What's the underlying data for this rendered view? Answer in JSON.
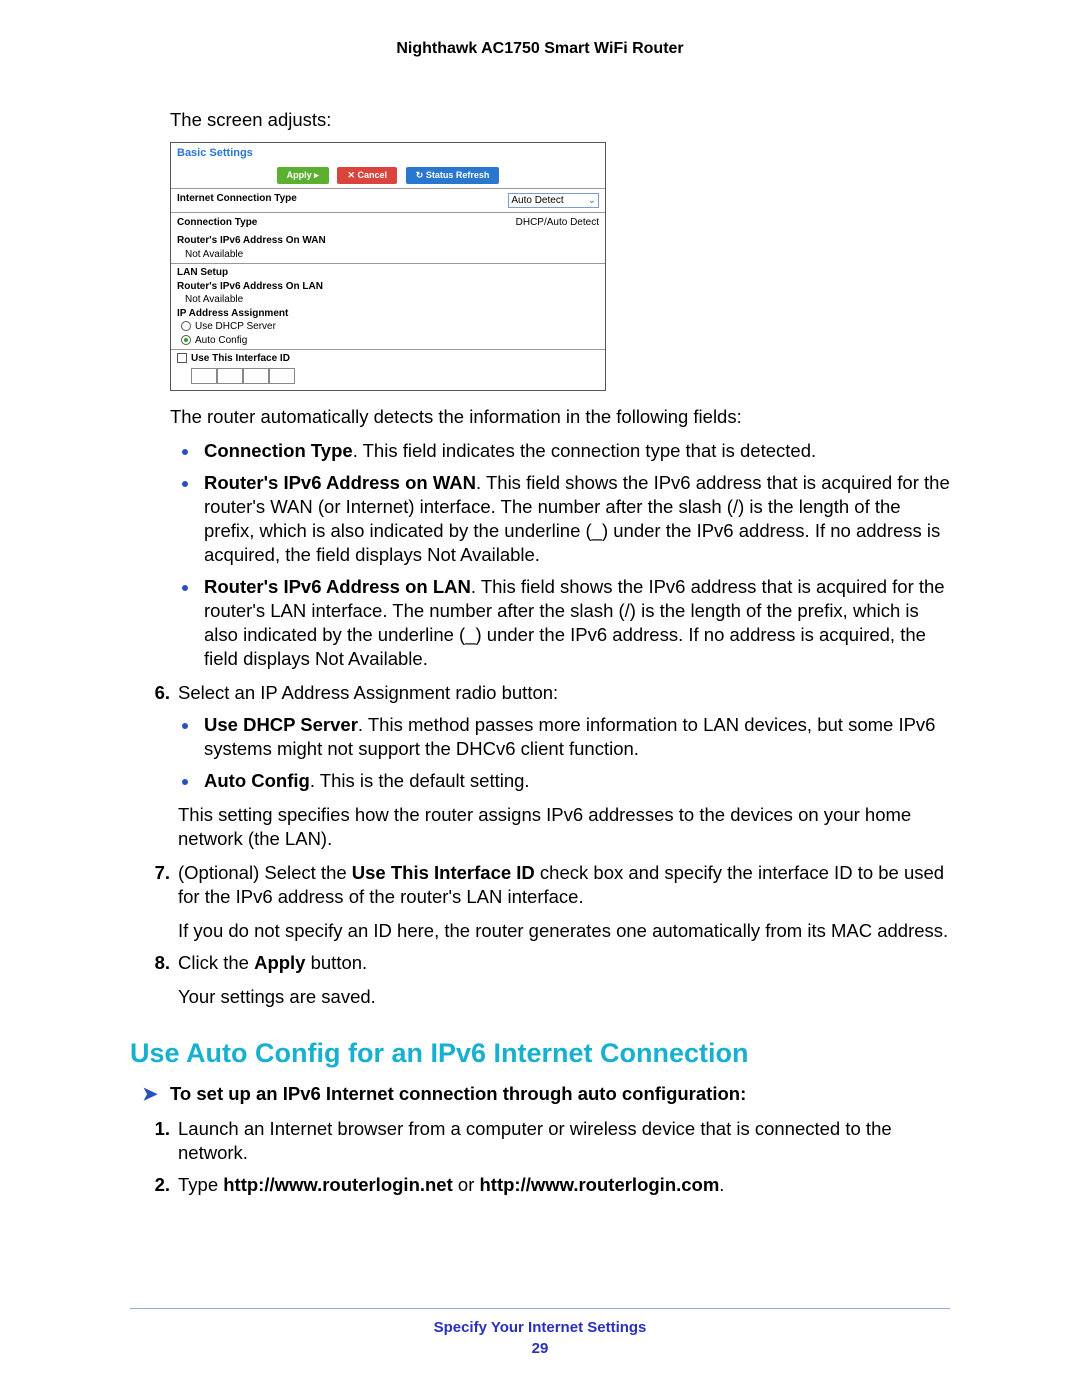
{
  "header": {
    "title": "Nighthawk AC1750 Smart WiFi Router"
  },
  "intro": "The screen adjusts:",
  "ui": {
    "title": "Basic Settings",
    "buttons": {
      "apply": "Apply ▸",
      "cancel": "✕ Cancel",
      "refresh": "↻ Status Refresh"
    },
    "ict_label": "Internet Connection Type",
    "ict_value": "Auto Detect",
    "conn_type_label": "Connection Type",
    "conn_type_value": "DHCP/Auto Detect",
    "wan_addr_label": "Router's IPv6 Address On WAN",
    "wan_addr_value": "Not Available",
    "lan_setup": "LAN Setup",
    "lan_addr_label": "Router's IPv6 Address On LAN",
    "lan_addr_value": "Not Available",
    "ip_assign": "IP Address Assignment",
    "opt_dhcp": "Use DHCP Server",
    "opt_auto": "Auto Config",
    "use_iface": "Use This Interface ID"
  },
  "after_ui": "The router automatically detects the information in the following fields:",
  "bullets1": {
    "b1_bold": "Connection Type",
    "b1_rest": ". This field indicates the connection type that is detected.",
    "b2_bold": "Router's IPv6 Address on WAN",
    "b2_rest": ". This field shows the IPv6 address that is acquired for the router's WAN (or Internet) interface. The number after the slash (/) is the length of the prefix, which is also indicated by the underline (_) under the IPv6 address. If no address is acquired, the field displays Not Available.",
    "b3_bold": "Router's IPv6 Address on LAN",
    "b3_rest": ". This field shows the IPv6 address that is acquired for the router's LAN interface. The number after the slash (/) is the length of the prefix, which is also indicated by the underline (_) under the IPv6 address. If no address is acquired, the field displays Not Available."
  },
  "step6": {
    "num": "6.",
    "lead": "Select an IP Address Assignment radio button:",
    "b1_bold": "Use DHCP Server",
    "b1_rest": ". This method passes more information to LAN devices, but some IPv6 systems might not support the DHCv6 client function.",
    "b2_bold": "Auto Config",
    "b2_rest": ". This is the default setting.",
    "tail": "This setting specifies how the router assigns IPv6 addresses to the devices on your home network (the LAN)."
  },
  "step7": {
    "num": "7.",
    "pre": "(Optional) Select the ",
    "bold": "Use This Interface ID",
    "post": " check box and specify the interface ID to be used for the IPv6 address of the router's LAN interface.",
    "tail": "If you do not specify an ID here, the router generates one automatically from its MAC address."
  },
  "step8": {
    "num": "8.",
    "pre": "Click the ",
    "bold": "Apply",
    "post": " button.",
    "tail": "Your settings are saved."
  },
  "section_h2": "Use Auto Config for an IPv6 Internet Connection",
  "task": "To set up an IPv6 Internet connection through auto configuration:",
  "steps2": {
    "s1_num": "1.",
    "s1": "Launch an Internet browser from a computer or wireless device that is connected to the network.",
    "s2_num": "2.",
    "s2_pre": "Type ",
    "s2_b1": "http://www.routerlogin.net",
    "s2_mid": " or ",
    "s2_b2": "http://www.routerlogin.com",
    "s2_post": "."
  },
  "footer": {
    "title": "Specify Your Internet Settings",
    "page": "29"
  }
}
